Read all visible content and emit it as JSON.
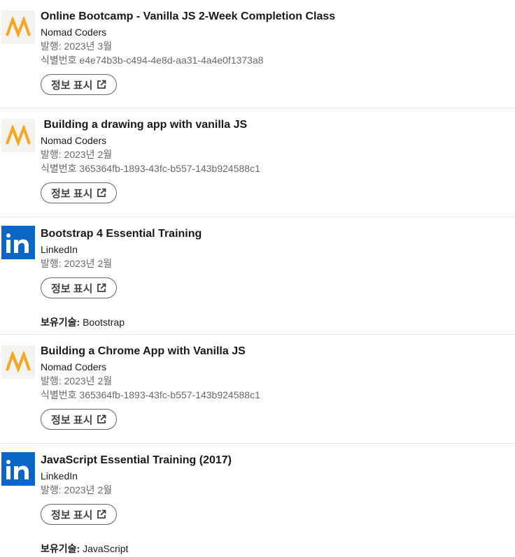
{
  "show_credential_label": "정보 표시",
  "skills_label": "보유기술:",
  "certificates": [
    {
      "title": "Online Bootcamp - Vanilla JS 2-Week Completion Class",
      "issuer": "Nomad Coders",
      "issued": "발행: 2023년 3월",
      "credential_id": "식별번호 e4e74b3b-c494-4e8d-aa31-4a4e0f1373a8",
      "logo_icon": "nomad-coders-logo",
      "skills": null
    },
    {
      "title": " Building a drawing app with vanilla JS",
      "issuer": "Nomad Coders",
      "issued": "발행: 2023년 2월",
      "credential_id": "식별번호 365364fb-1893-43fc-b557-143b924588c1",
      "logo_icon": "nomad-coders-logo",
      "skills": null
    },
    {
      "title": "Bootstrap 4 Essential Training",
      "issuer": "LinkedIn",
      "issued": "발행: 2023년 2월",
      "credential_id": null,
      "logo_icon": "linkedin-logo",
      "skills": "Bootstrap"
    },
    {
      "title": "Building a Chrome App with Vanilla JS",
      "issuer": "Nomad Coders",
      "issued": "발행: 2023년 2월",
      "credential_id": "식별번호 365364fb-1893-43fc-b557-143b924588c1",
      "logo_icon": "nomad-coders-logo",
      "skills": null
    },
    {
      "title": "JavaScript Essential Training (2017)",
      "issuer": "LinkedIn",
      "issued": "발행: 2023년 2월",
      "credential_id": null,
      "logo_icon": "linkedin-logo",
      "skills": "JavaScript"
    }
  ],
  "colors": {
    "nomad_orange": "#f5a623",
    "linkedin_blue": "#0a66c2",
    "divider": "#e8e8e8"
  }
}
